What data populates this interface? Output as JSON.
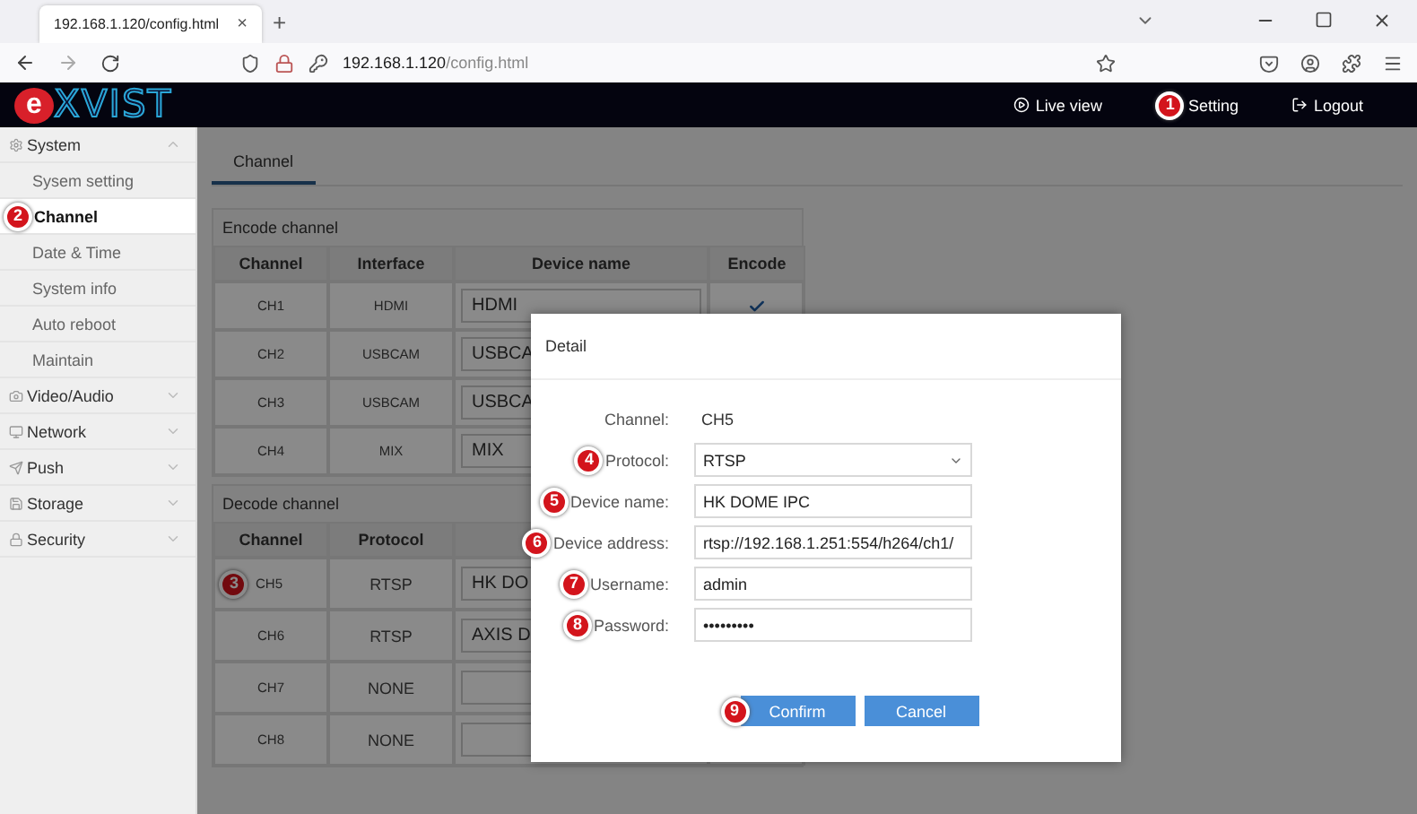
{
  "browser": {
    "tab": {
      "title": "192.168.1.120/config.html",
      "close": "×"
    },
    "new_tab": "+",
    "url": {
      "host": "192.168.1.120",
      "path": "/config.html"
    }
  },
  "header": {
    "logo": {
      "mark": "e",
      "text": "XVIST"
    },
    "nav": [
      {
        "label": "Live view"
      },
      {
        "label": "Setting",
        "badge": "1"
      },
      {
        "label": "Logout"
      }
    ]
  },
  "sidebar": {
    "groups": [
      {
        "label": "System",
        "expanded": true,
        "children": [
          {
            "label": "Sysem setting",
            "selected": false
          },
          {
            "label": "Channel",
            "selected": true,
            "badge": "2"
          },
          {
            "label": "Date & Time",
            "selected": false
          },
          {
            "label": "System info",
            "selected": false
          },
          {
            "label": "Auto reboot",
            "selected": false
          },
          {
            "label": "Maintain",
            "selected": false
          }
        ]
      },
      {
        "label": "Video/Audio",
        "expanded": false
      },
      {
        "label": "Network",
        "expanded": false
      },
      {
        "label": "Push",
        "expanded": false
      },
      {
        "label": "Storage",
        "expanded": false
      },
      {
        "label": "Security",
        "expanded": false
      }
    ]
  },
  "tabs": [
    {
      "label": "Channel",
      "selected": true
    }
  ],
  "encode_channel": {
    "title": "Encode channel",
    "columns": [
      "Channel",
      "Interface",
      "Device name",
      "Encode"
    ],
    "rows": [
      {
        "channel": "CH1",
        "interface": "HDMI",
        "device_name": "HDMI",
        "encode": true
      },
      {
        "channel": "CH2",
        "interface": "USBCAM",
        "device_name": "USBCA"
      },
      {
        "channel": "CH3",
        "interface": "USBCAM",
        "device_name": "USBCA"
      },
      {
        "channel": "CH4",
        "interface": "MIX",
        "device_name": "MIX"
      }
    ]
  },
  "decode_channel": {
    "title": "Decode channel",
    "columns": [
      "Channel",
      "Protocol"
    ],
    "rows": [
      {
        "channel": "CH5",
        "protocol": "RTSP",
        "device_name": "HK DO",
        "badge": "3"
      },
      {
        "channel": "CH6",
        "protocol": "RTSP",
        "device_name": "AXIS D"
      },
      {
        "channel": "CH7",
        "protocol": "NONE"
      },
      {
        "channel": "CH8",
        "protocol": "NONE"
      }
    ]
  },
  "dialog": {
    "title": "Detail",
    "fields": [
      {
        "kind": "text",
        "label": "Channel:",
        "value": "CH5"
      },
      {
        "kind": "select",
        "label": "Protocol:",
        "value": "RTSP",
        "badge": "4"
      },
      {
        "kind": "input",
        "label": "Device name:",
        "value": "HK DOME IPC",
        "badge": "5"
      },
      {
        "kind": "input",
        "label": "Device address:",
        "value": "rtsp://192.168.1.251:554/h264/ch1/",
        "badge": "6"
      },
      {
        "kind": "input",
        "label": "Username:",
        "value": "admin",
        "badge": "7"
      },
      {
        "kind": "input",
        "label": "Password:",
        "value": "•••••••••",
        "badge": "8"
      }
    ],
    "buttons": [
      {
        "label": "Confirm",
        "badge": "9"
      },
      {
        "label": "Cancel"
      }
    ]
  }
}
